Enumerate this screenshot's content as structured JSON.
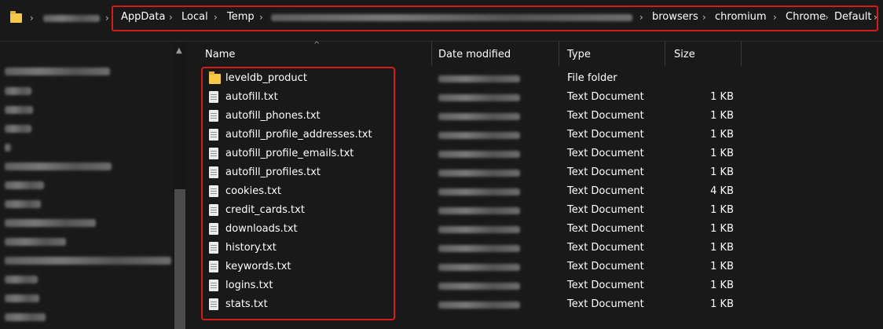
{
  "address_bar": {
    "crumbs": [
      "AppData",
      "Local",
      "Temp",
      "browsers",
      "chromium",
      "Chrome",
      "Default"
    ]
  },
  "columns": {
    "name": "Name",
    "date_modified": "Date modified",
    "type": "Type",
    "size": "Size"
  },
  "files": [
    {
      "name": "leveldb_product",
      "type": "File folder",
      "size": "",
      "icon": "folder-icon"
    },
    {
      "name": "autofill.txt",
      "type": "Text Document",
      "size": "1 KB",
      "icon": "text-file-icon"
    },
    {
      "name": "autofill_phones.txt",
      "type": "Text Document",
      "size": "1 KB",
      "icon": "text-file-icon"
    },
    {
      "name": "autofill_profile_addresses.txt",
      "type": "Text Document",
      "size": "1 KB",
      "icon": "text-file-icon"
    },
    {
      "name": "autofill_profile_emails.txt",
      "type": "Text Document",
      "size": "1 KB",
      "icon": "text-file-icon"
    },
    {
      "name": "autofill_profiles.txt",
      "type": "Text Document",
      "size": "1 KB",
      "icon": "text-file-icon"
    },
    {
      "name": "cookies.txt",
      "type": "Text Document",
      "size": "4 KB",
      "icon": "text-file-icon"
    },
    {
      "name": "credit_cards.txt",
      "type": "Text Document",
      "size": "1 KB",
      "icon": "text-file-icon"
    },
    {
      "name": "downloads.txt",
      "type": "Text Document",
      "size": "1 KB",
      "icon": "text-file-icon"
    },
    {
      "name": "history.txt",
      "type": "Text Document",
      "size": "1 KB",
      "icon": "text-file-icon"
    },
    {
      "name": "keywords.txt",
      "type": "Text Document",
      "size": "1 KB",
      "icon": "text-file-icon"
    },
    {
      "name": "logins.txt",
      "type": "Text Document",
      "size": "1 KB",
      "icon": "text-file-icon"
    },
    {
      "name": "stats.txt",
      "type": "Text Document",
      "size": "1 KB",
      "icon": "text-file-icon"
    }
  ],
  "colors": {
    "background": "#191919",
    "highlight_border": "#d41c1c",
    "folder": "#f7c948"
  }
}
